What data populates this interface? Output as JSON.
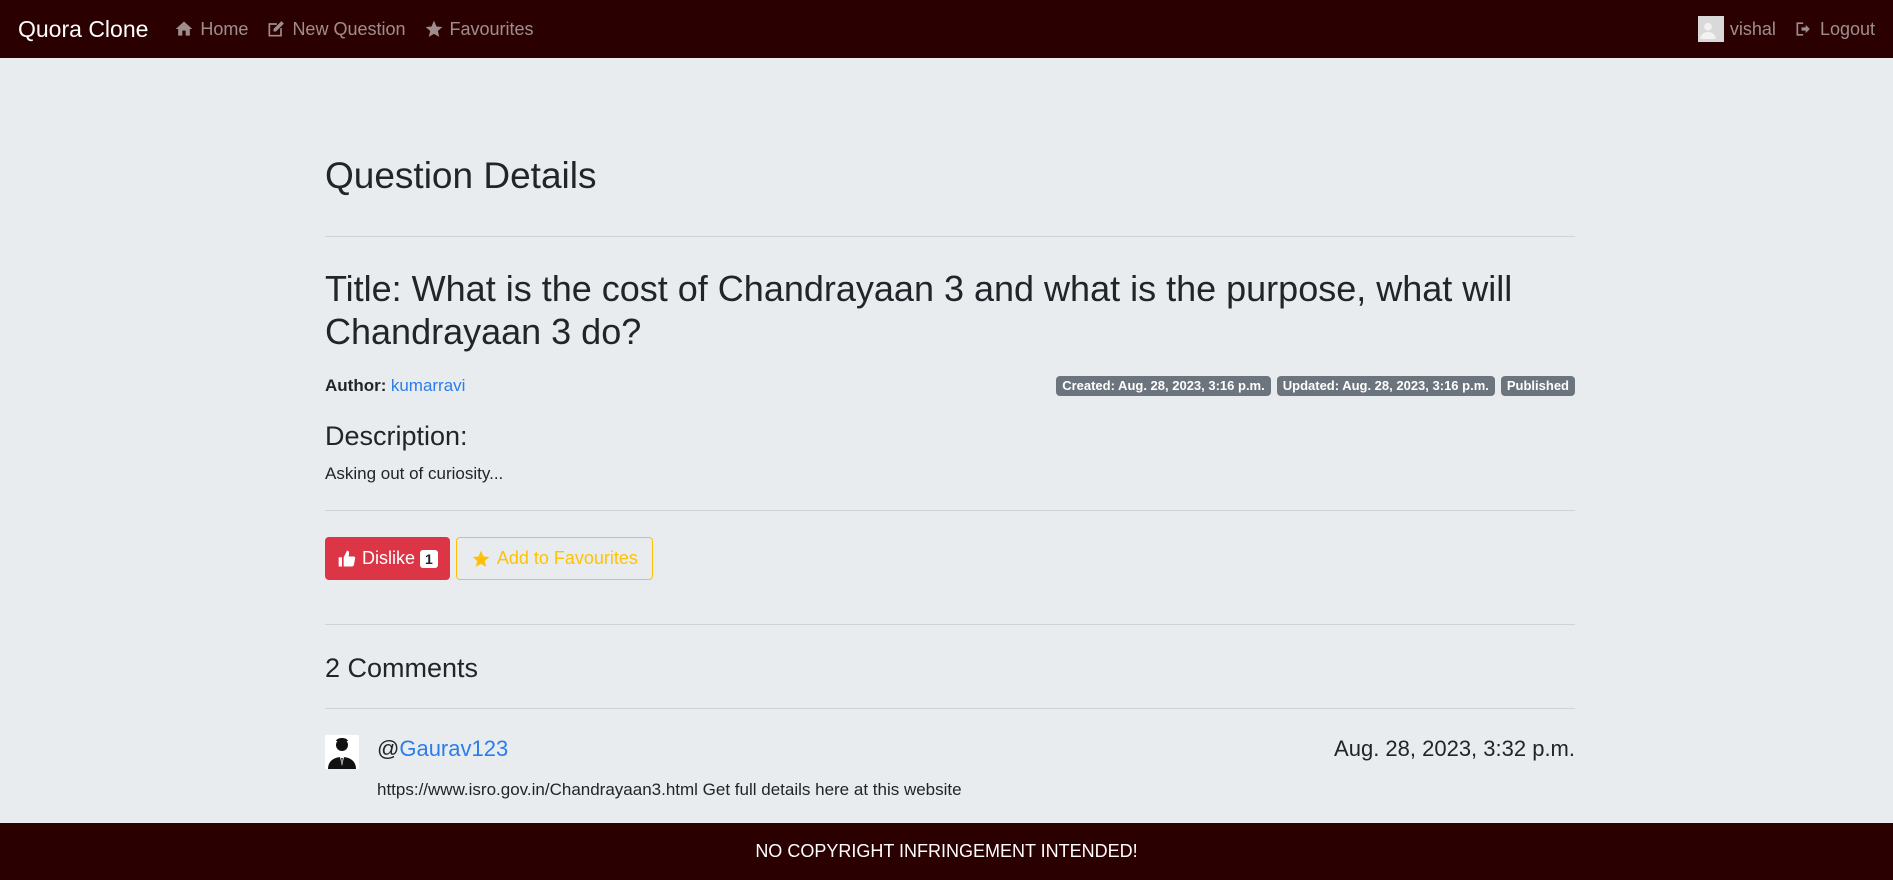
{
  "navbar": {
    "brand": "Quora Clone",
    "links": [
      {
        "label": "Home",
        "icon": "home-icon"
      },
      {
        "label": "New Question",
        "icon": "edit-icon"
      },
      {
        "label": "Favourites",
        "icon": "star-icon"
      }
    ],
    "user": {
      "name": "vishal",
      "icon": "user-avatar-icon"
    },
    "logout": {
      "label": "Logout",
      "icon": "logout-icon"
    }
  },
  "page": {
    "heading": "Question Details"
  },
  "question": {
    "title": "Title: What is the cost of Chandrayaan 3 and what is the purpose, what will Chandrayaan 3 do?",
    "author_label": "Author:",
    "author": "kumarravi",
    "badges": {
      "created": "Created: Aug. 28, 2023, 3:16 p.m.",
      "updated": "Updated: Aug. 28, 2023, 3:16 p.m.",
      "status": "Published"
    },
    "description_heading": "Description:",
    "description": "Asking out of curiosity..."
  },
  "actions": {
    "dislike_label": "Dislike",
    "dislike_count": "1",
    "favourite_label": "Add to Favourites",
    "colors": {
      "dislike": "#dc3545",
      "favourite": "#ffc107"
    }
  },
  "comments": {
    "heading": "2 Comments",
    "items": [
      {
        "at": "@",
        "user": "Gaurav123",
        "date": "Aug. 28, 2023, 3:32 p.m.",
        "text": "https://www.isro.gov.in/Chandrayaan3.html Get full details here at this website"
      }
    ]
  },
  "footer": {
    "text": "NO COPYRIGHT INFRINGEMENT INTENDED!"
  },
  "theme": {
    "navbar_bg": "#2b0000",
    "page_bg": "#e9ecef",
    "link_color": "#2b7de9"
  }
}
